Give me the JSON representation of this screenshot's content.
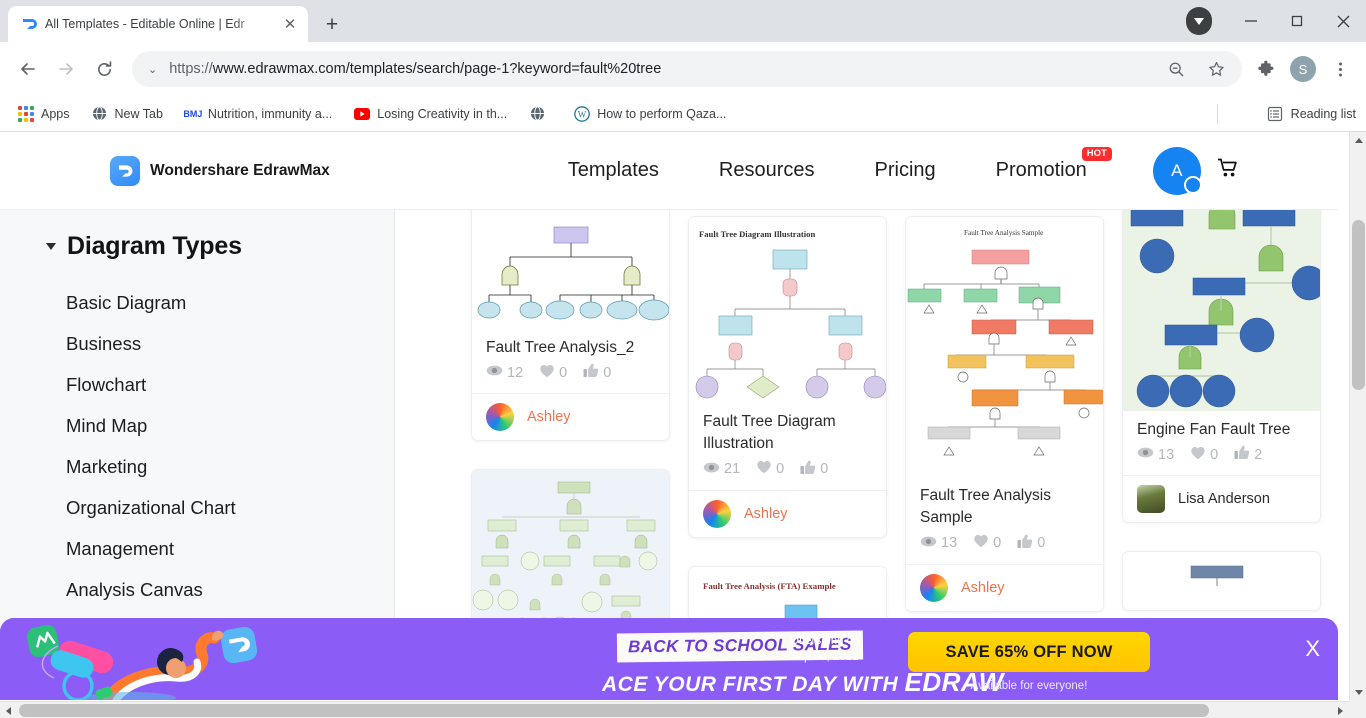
{
  "browser": {
    "tab": {
      "title": "All Templates - Editable Online | Edr",
      "close_label": "✕",
      "favicon_name": "edrawmax-favicon"
    },
    "new_tab_label": "+",
    "window": {
      "minimize": "—",
      "maximize": "❐",
      "close": "✕"
    },
    "nav": {
      "back": "←",
      "forward": "→",
      "reload": "⟳"
    },
    "omnibox": {
      "chevron": "⌄",
      "scheme": "https://",
      "url_rest": "www.edrawmax.com/templates/search/page-1?keyword=fault%20tree",
      "full_url": "https://www.edrawmax.com/templates/search/page-1?keyword=fault%20tree"
    },
    "profile_letter": "S",
    "bookmarks": [
      {
        "label": "Apps",
        "icon": "apps-grid-icon"
      },
      {
        "label": "New Tab",
        "icon": "globe-icon"
      },
      {
        "label": "Nutrition, immunity a...",
        "icon": "bmj-icon",
        "icon_text": "BMJ"
      },
      {
        "label": "Losing Creativity in th...",
        "icon": "youtube-icon"
      },
      {
        "label": "",
        "icon": "globe-icon"
      },
      {
        "label": "How to perform Qaza...",
        "icon": "wordpress-icon"
      }
    ],
    "reading_list": {
      "label": "Reading list",
      "icon": "reading-list-icon"
    }
  },
  "site": {
    "brand": "Wondershare EdrawMax",
    "nav": [
      {
        "label": "Templates",
        "badge": ""
      },
      {
        "label": "Resources",
        "badge": ""
      },
      {
        "label": "Pricing",
        "badge": ""
      },
      {
        "label": "Promotion",
        "badge": "HOT"
      }
    ],
    "user_initial": "A",
    "cart_icon": "shopping-cart-icon"
  },
  "sidebar": {
    "title": "Diagram Types",
    "items": [
      {
        "label": "Basic Diagram"
      },
      {
        "label": "Business"
      },
      {
        "label": "Flowchart"
      },
      {
        "label": "Mind Map"
      },
      {
        "label": "Marketing"
      },
      {
        "label": "Organizational Chart"
      },
      {
        "label": "Management"
      },
      {
        "label": "Analysis Canvas"
      }
    ]
  },
  "templates": {
    "columns": [
      {
        "cards": [
          {
            "title": "Fault Tree Analysis_2",
            "views": "12",
            "likes": "0",
            "thumbs": "0",
            "author": "Ashley",
            "author_style": "orange",
            "thumb_caption": "",
            "thumb_kind": "purple-top-gate-tree",
            "clipped_top": true
          },
          {
            "title": "",
            "views": "",
            "likes": "",
            "thumbs": "",
            "author": "",
            "author_style": "orange",
            "thumb_caption": "",
            "thumb_kind": "green-large-tree",
            "clipped_bottom": true
          }
        ]
      },
      {
        "cards": [
          {
            "title": "Fault Tree Diagram Illustration",
            "views": "21",
            "likes": "0",
            "thumbs": "0",
            "author": "Ashley",
            "author_style": "orange",
            "thumb_caption": "Fault Tree Diagram Illustration",
            "thumb_kind": "blue-pink-tree"
          },
          {
            "title": "",
            "views": "",
            "likes": "",
            "thumbs": "",
            "author": "",
            "author_style": "orange",
            "thumb_caption": "Fault Tree Analysis (FTA) Example",
            "thumb_kind": "fta-example",
            "clipped_bottom": true
          }
        ]
      },
      {
        "cards": [
          {
            "title": "Fault Tree Analysis Sample",
            "views": "13",
            "likes": "0",
            "thumbs": "0",
            "author": "Ashley",
            "author_style": "orange",
            "thumb_caption": "Fault Tree Analysis Sample",
            "thumb_kind": "multicolor-tree"
          }
        ]
      },
      {
        "cards": [
          {
            "title": "Engine Fan Fault Tree",
            "views": "13",
            "likes": "0",
            "thumbs": "2",
            "author": "Lisa Anderson",
            "author_style": "dark",
            "thumb_caption": "",
            "thumb_kind": "engine-fan-tree",
            "clipped_top": true
          },
          {
            "title": "",
            "views": "",
            "likes": "",
            "thumbs": "",
            "author": "",
            "author_style": "dark",
            "thumb_caption": "",
            "thumb_kind": "grey-node",
            "clipped_bottom": true
          }
        ]
      }
    ],
    "stat_icons": {
      "views": "eye-icon",
      "likes": "heart-icon",
      "thumbs": "thumbs-up-icon"
    }
  },
  "banner": {
    "tagline": "BACK TO SCHOOL SALES",
    "offer_line1": "Offers end on",
    "offer_line2": "Sep 30, 2021",
    "headline_small": "ACE YOUR FIRST DAY WITH",
    "headline_big": "EDRAW",
    "cta": "SAVE 65% OFF NOW",
    "subtext": "Available for everyone!",
    "close": "X"
  },
  "colors": {
    "brand_blue": "#1583f2",
    "banner_purple": "#8b5cf6",
    "cta_yellow": "#ffd000",
    "author_orange": "#f2724b",
    "hot_red": "#ff2d2d"
  }
}
